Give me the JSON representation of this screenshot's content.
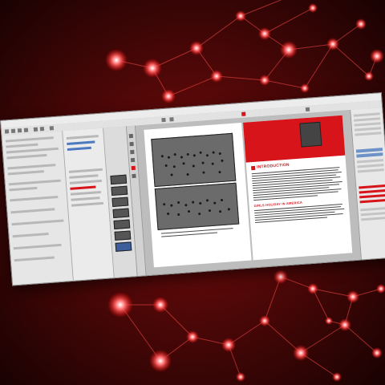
{
  "headings": {
    "introduction": "INTRODUCTION",
    "section2": "GIRLS HOLIDAY IN AMERICA"
  },
  "colors": {
    "accent": "#d8141b",
    "background": "#3a0606",
    "network": "#ff3a3a"
  }
}
